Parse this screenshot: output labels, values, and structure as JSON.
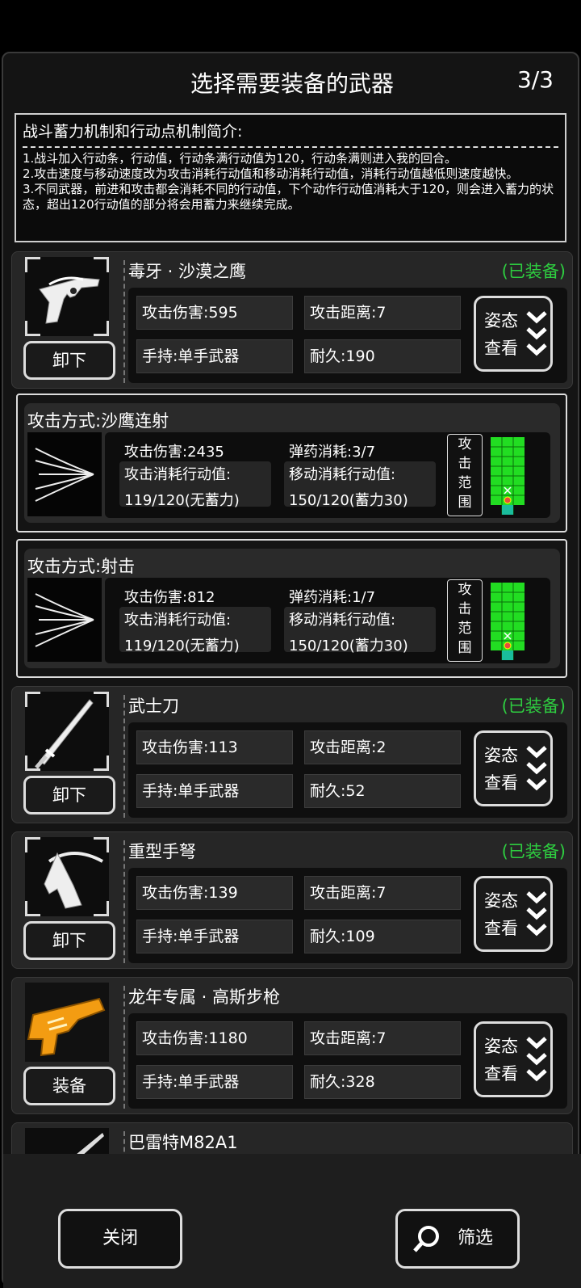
{
  "header": {
    "title": "选择需要装备的武器",
    "page": "3/3"
  },
  "intro": {
    "heading": "战斗蓄力机制和行动点机制简介:",
    "lines": [
      "1.战斗加入行动条，行动值，行动条满行动值为120，行动条满则进入我的回合。",
      "2.攻击速度与移动速度改为攻击消耗行动值和移动消耗行动值，消耗行动值越低则速度越快。",
      "3.不同武器，前进和攻击都会消耗不同的行动值，下个动作行动值消耗大于120，则会进入蓄力的状态，超出120行动值的部分将会用蓄力来继续完成。"
    ]
  },
  "labels": {
    "pose_line1": "姿态",
    "pose_line2": "查看",
    "range_btn": "攻击范围"
  },
  "weapons": [
    {
      "name": "毒牙 · 沙漠之鹰",
      "status": "(已装备)",
      "button": "卸下",
      "damage": "攻击伤害:595",
      "range": "攻击距离:7",
      "hold": "手持:单手武器",
      "durability": "耐久:190",
      "icon": "revolver-icon"
    },
    {
      "name": "武士刀",
      "status": "(已装备)",
      "button": "卸下",
      "damage": "攻击伤害:113",
      "range": "攻击距离:2",
      "hold": "手持:单手武器",
      "durability": "耐久:52",
      "icon": "katana-icon"
    },
    {
      "name": "重型手弩",
      "status": "(已装备)",
      "button": "卸下",
      "damage": "攻击伤害:139",
      "range": "攻击距离:7",
      "hold": "手持:单手武器",
      "durability": "耐久:109",
      "icon": "crossbow-icon"
    },
    {
      "name": "龙年专属 · 高斯步枪",
      "status": "",
      "button": "装备",
      "damage": "攻击伤害:1180",
      "range": "攻击距离:7",
      "hold": "手持:单手武器",
      "durability": "耐久:328",
      "icon": "gauss-rifle-icon"
    },
    {
      "name": "巴雷特M82A1",
      "icon": "sniper-rifle-icon"
    }
  ],
  "attacks": [
    {
      "name": "攻击方式:沙鹰连射",
      "damage": "攻击伤害:2435",
      "ammo": "弹药消耗:3/7",
      "atk_cost_label": "攻击消耗行动值:",
      "atk_cost": "119/120(无蓄力)",
      "move_cost_label": "移动消耗行动值:",
      "move_cost": "150/120(蓄力30)"
    },
    {
      "name": "攻击方式:射击",
      "damage": "攻击伤害:812",
      "ammo": "弹药消耗:1/7",
      "atk_cost_label": "攻击消耗行动值:",
      "atk_cost": "119/120(无蓄力)",
      "move_cost_label": "移动消耗行动值:",
      "move_cost": "150/120(蓄力30)"
    }
  ],
  "footer": {
    "close": "关闭",
    "filter": "筛选"
  },
  "colors": {
    "equipped": "#2ecc40",
    "range_green": "#22dd22",
    "player_cell": "#1abc9c"
  }
}
